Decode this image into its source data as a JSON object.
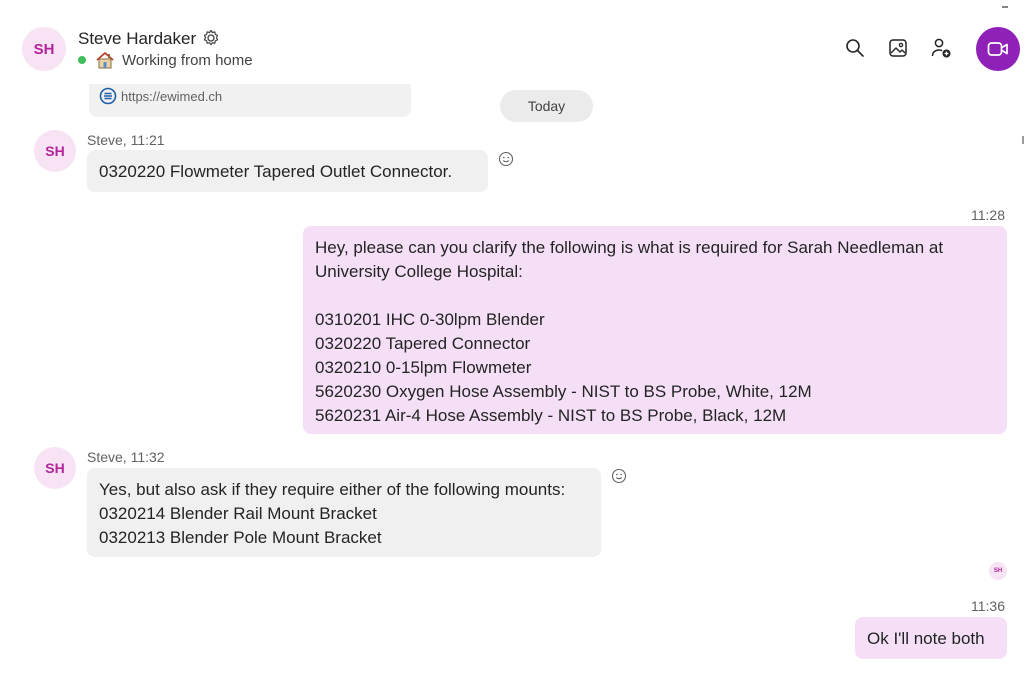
{
  "header": {
    "avatar_initials": "SH",
    "name": "Steve Hardaker",
    "status": "Working from home",
    "status_color": "#3fbf5a",
    "icons": [
      "gear-icon",
      "search-icon",
      "gallery-icon",
      "add-person-icon",
      "video-call-icon"
    ],
    "accent": "#8f20b8"
  },
  "link_preview": {
    "url": "https://ewimed.ch"
  },
  "date_separator": "Today",
  "messages": [
    {
      "direction": "in",
      "avatar": "SH",
      "meta": "Steve, 11:21",
      "lines": [
        "0320220  Flowmeter Tapered Outlet Connector."
      ]
    },
    {
      "direction": "out",
      "time": "11:28",
      "lines": [
        "Hey, please can you clarify the following is what is required for Sarah Needleman at",
        "University College Hospital:",
        "",
        "0310201 IHC 0-30lpm Blender",
        "0320220 Tapered Connector",
        "0320210 0-15lpm Flowmeter",
        "5620230 Oxygen Hose Assembly - NIST to BS Probe, White, 12M",
        "5620231 Air-4 Hose Assembly - NIST to BS Probe, Black, 12M"
      ]
    },
    {
      "direction": "in",
      "avatar": "SH",
      "meta": "Steve, 11:32",
      "lines": [
        "Yes, but also ask if they require either of the following mounts:",
        "0320214 Blender Rail Mount Bracket",
        "0320213 Blender Pole Mount Bracket"
      ]
    },
    {
      "direction": "out",
      "time": "11:36",
      "read_receipt": "SH",
      "lines": [
        "Ok I'll note both"
      ]
    }
  ]
}
